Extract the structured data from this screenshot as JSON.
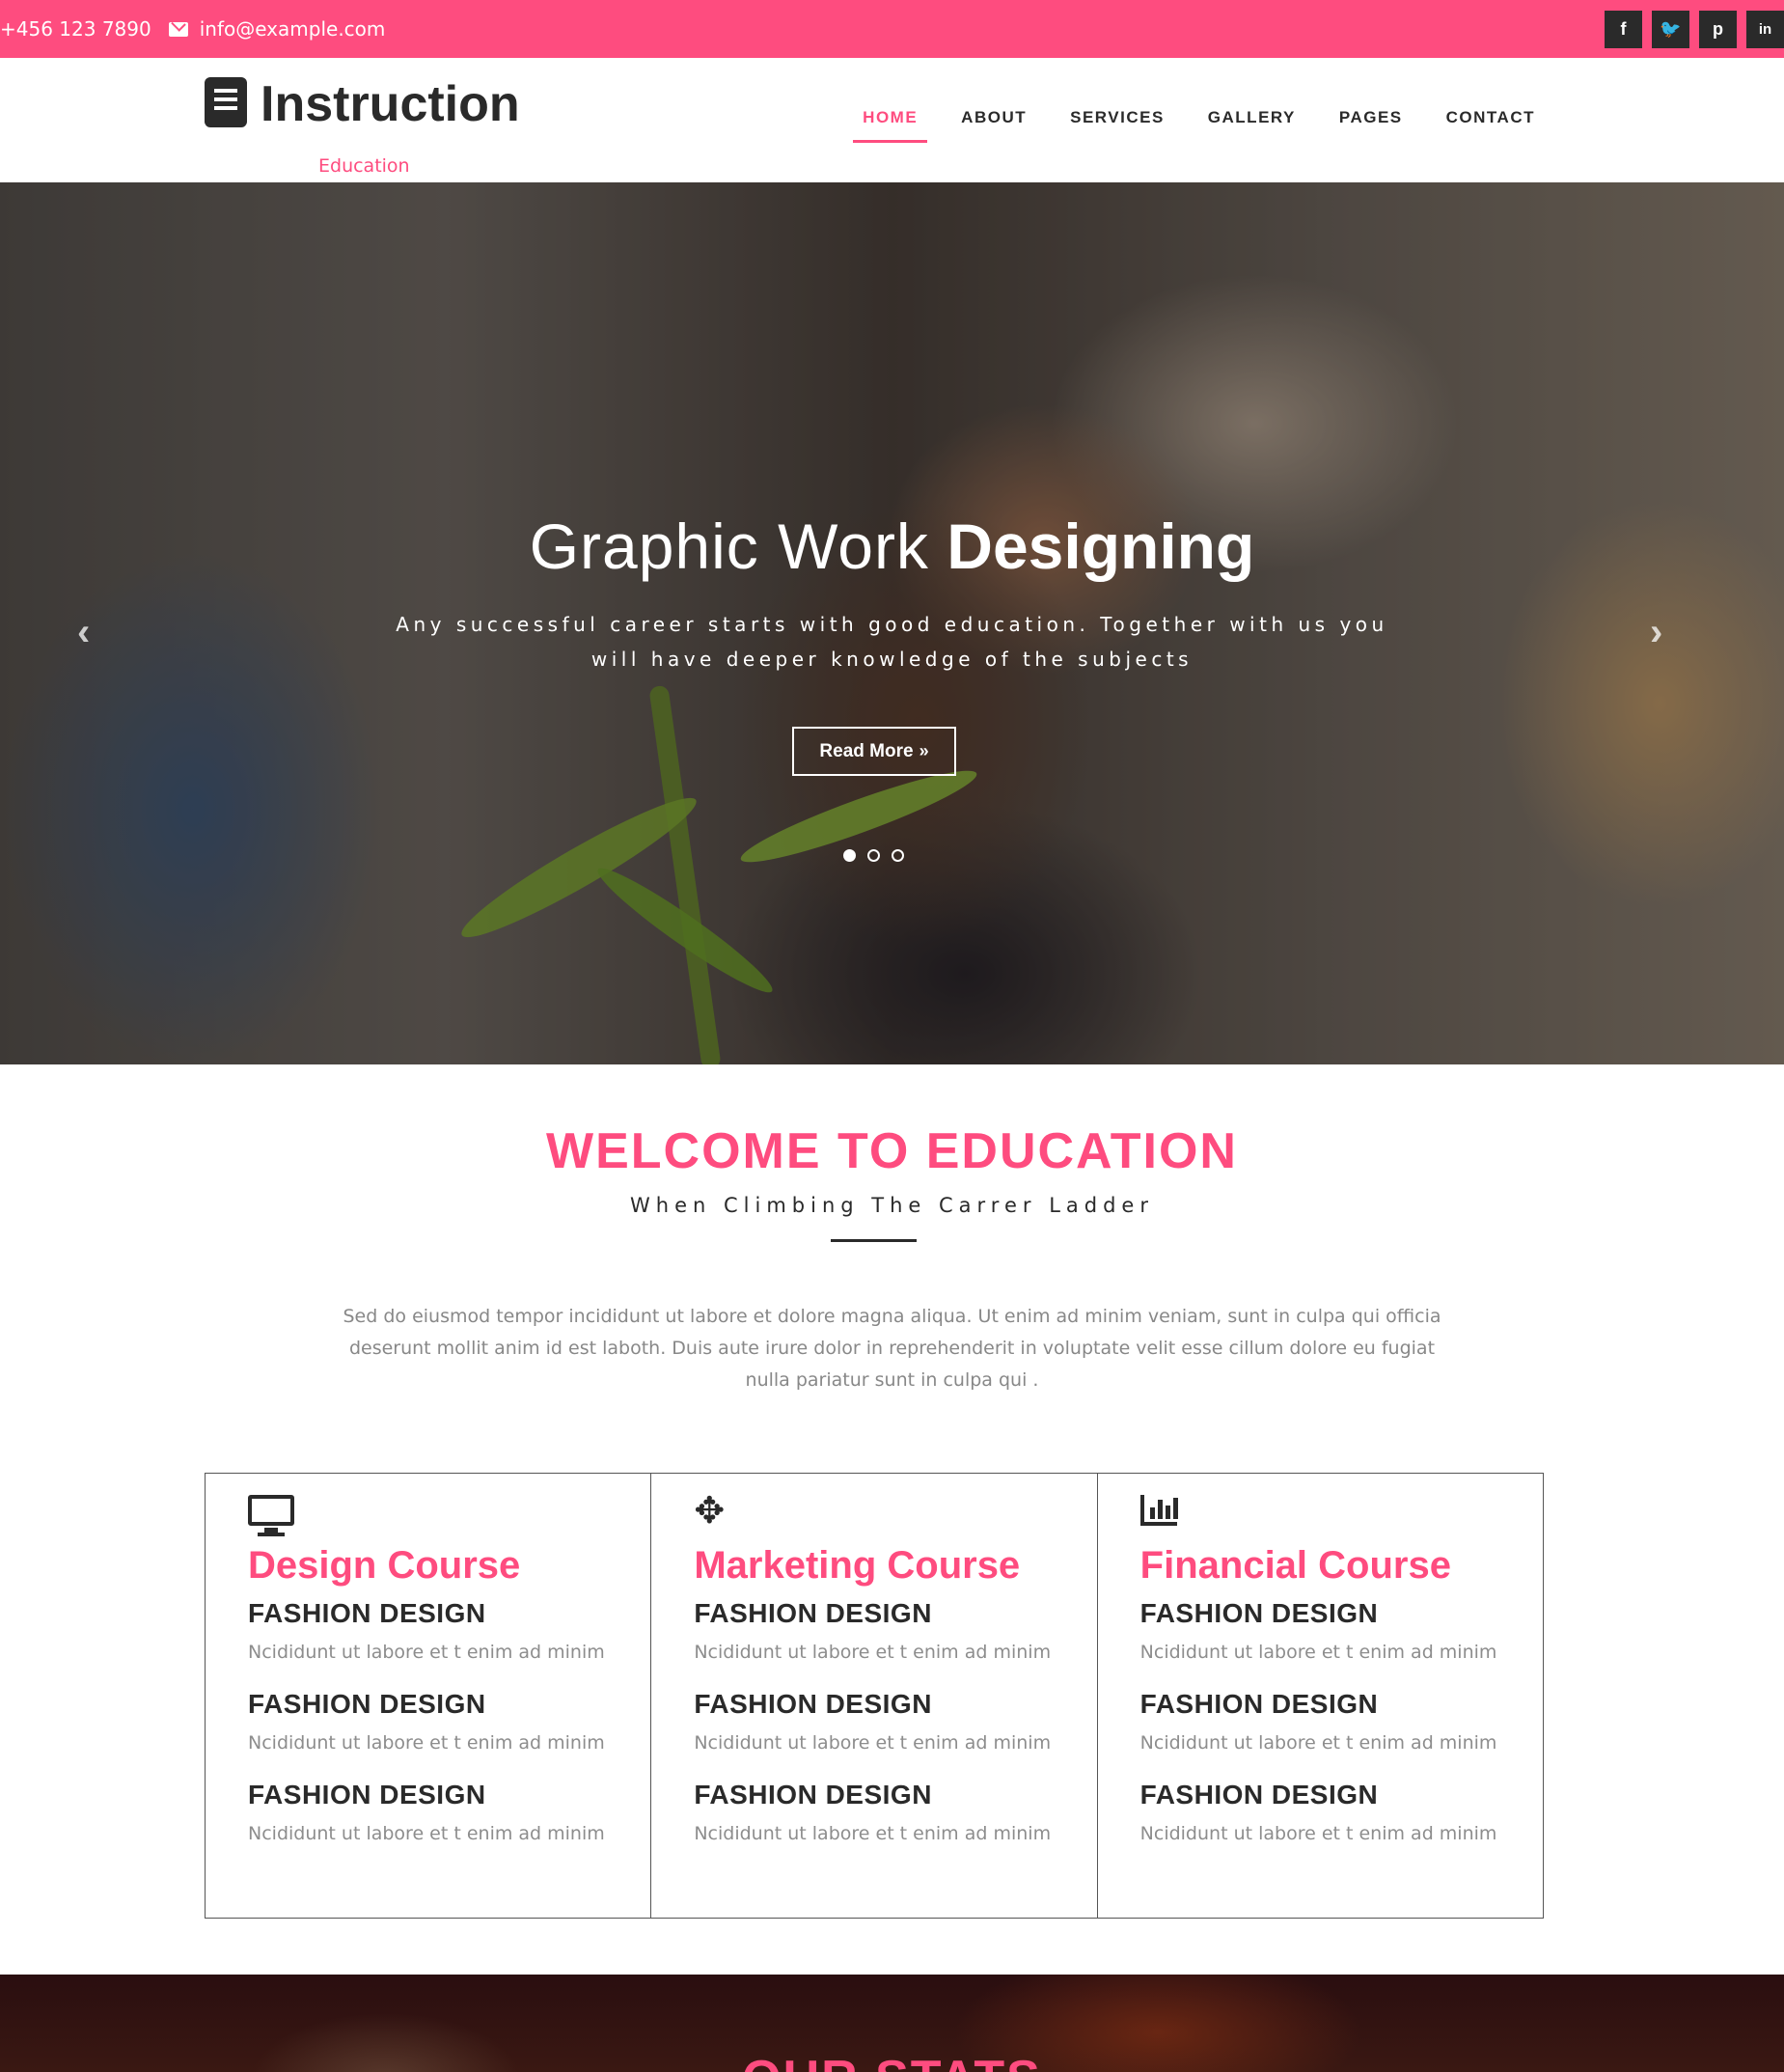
{
  "topbar": {
    "phone": "+456 123 7890",
    "email": "info@example.com",
    "social": [
      {
        "icon": "facebook-icon",
        "glyph": "f"
      },
      {
        "icon": "twitter-icon",
        "glyph": "t"
      },
      {
        "icon": "pinterest-icon",
        "glyph": "p"
      },
      {
        "icon": "linkedin-icon",
        "glyph": "in"
      }
    ],
    "color": "#fe4c7f"
  },
  "header": {
    "logo_name": "Instruction",
    "logo_sub": "Education",
    "nav": [
      "HOME",
      "ABOUT",
      "SERVICES",
      "GALLERY",
      "PAGES",
      "CONTACT"
    ],
    "active": "HOME"
  },
  "hero": {
    "title_light": "Graphic Work",
    "title_bold": "Designing",
    "text": "Any successful career starts with good education. Together with us you will have deeper knowledge of the subjects",
    "button": "Read More",
    "button_icon": "double-chevron-right-icon",
    "slides": 3,
    "active_slide": 1
  },
  "welcome": {
    "title": "WELCOME TO EDUCATION",
    "subtitle": "When Climbing The Carrer Ladder",
    "text": "Sed do eiusmod tempor incididunt ut labore et dolore magna aliqua. Ut enim ad minim veniam, sunt in culpa qui officia deserunt mollit anim id est laboth. Duis aute irure dolor in reprehenderit in voluptate velit esse cillum dolore eu fugiat nulla pariatur sunt in culpa qui ."
  },
  "courses": [
    {
      "icon": "monitor-icon",
      "title": "Design Course",
      "items": [
        {
          "heading": "FASHION DESIGN",
          "text": "Ncididunt ut labore et t enim ad minim"
        },
        {
          "heading": "FASHION DESIGN",
          "text": "Ncididunt ut labore et t enim ad minim"
        },
        {
          "heading": "FASHION DESIGN",
          "text": "Ncididunt ut labore et t enim ad minim"
        }
      ]
    },
    {
      "icon": "move-arrows-icon",
      "title": "Marketing Course",
      "items": [
        {
          "heading": "FASHION DESIGN",
          "text": "Ncididunt ut labore et t enim ad minim"
        },
        {
          "heading": "FASHION DESIGN",
          "text": "Ncididunt ut labore et t enim ad minim"
        },
        {
          "heading": "FASHION DESIGN",
          "text": "Ncididunt ut labore et t enim ad minim"
        }
      ]
    },
    {
      "icon": "bar-chart-icon",
      "title": "Financial Course",
      "items": [
        {
          "heading": "FASHION DESIGN",
          "text": "Ncididunt ut labore et t enim ad minim"
        },
        {
          "heading": "FASHION DESIGN",
          "text": "Ncididunt ut labore et t enim ad minim"
        },
        {
          "heading": "FASHION DESIGN",
          "text": "Ncididunt ut labore et t enim ad minim"
        }
      ]
    }
  ],
  "stats": {
    "title": "OUR STATS"
  }
}
